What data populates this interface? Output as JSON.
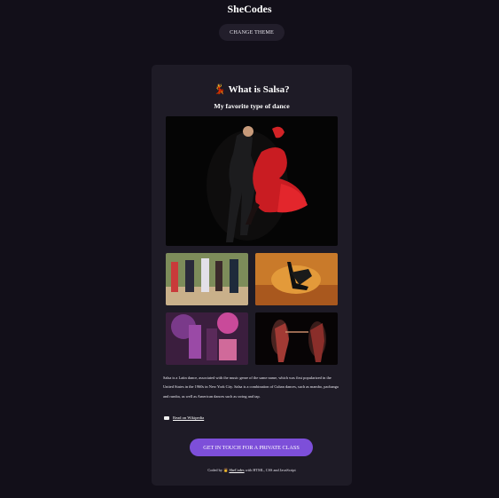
{
  "header": {
    "brand": "SheCodes",
    "theme_button": "CHANGE THEME"
  },
  "card": {
    "title_icon": "💃",
    "title": "What is Salsa?",
    "subtitle": "My favorite type of dance",
    "description": "Salsa is a Latin dance, associated with the music genre of the same name, which was first popularized in the United States in the 1960s in New York City. Salsa is a combination of Cuban dances, such as mambo, pachanga and rumba, as well as American dances such as swing and tap.",
    "wiki_link": "Read on Wikipedia",
    "cta_button": "GET IN TOUCH FOR A PRIVATE CLASS",
    "footer": {
      "coded_by": "Coded by",
      "emoji": "👩",
      "link": "SheCodes",
      "suffix": "with HTML, CSS and JavaScript"
    }
  },
  "colors": {
    "background": "#120f19",
    "card": "#1e1b26",
    "accent": "#7d4fd9"
  }
}
